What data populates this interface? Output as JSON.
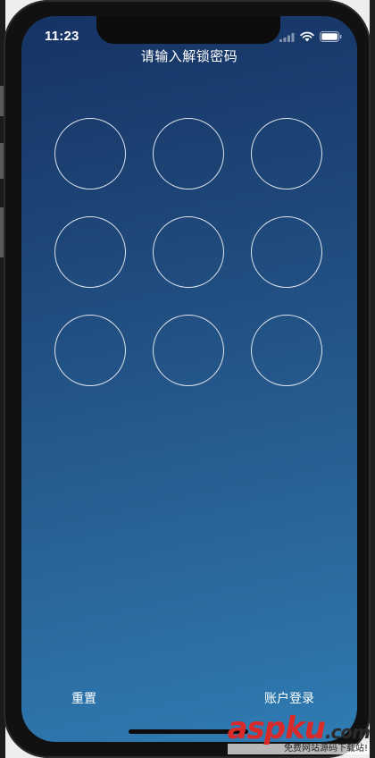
{
  "status_bar": {
    "time": "11:23",
    "icons": [
      "cellular-signal-icon",
      "wifi-icon",
      "battery-icon"
    ]
  },
  "lock_screen": {
    "prompt": "请输入解锁密码",
    "pattern_dots": [
      1,
      2,
      3,
      4,
      5,
      6,
      7,
      8,
      9
    ]
  },
  "footer": {
    "reset_label": "重置",
    "account_login_label": "账户登录"
  },
  "watermark": {
    "logo_main": "aspku",
    "logo_tld": ".com",
    "tagline": "免费网站源码下载站!"
  },
  "colors": {
    "gradient_top": "#163364",
    "gradient_bottom": "#2e7cb3",
    "ring": "#ffffff",
    "watermark_red": "#d92a2a"
  }
}
